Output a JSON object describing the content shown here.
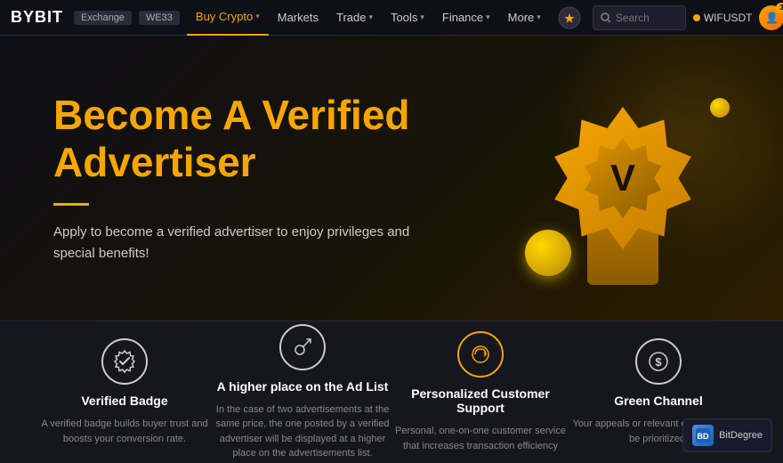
{
  "navbar": {
    "logo": "BYBIT",
    "exchange_tag": "Exchange",
    "we33_tag": "WE33",
    "links": [
      {
        "label": "Buy Crypto",
        "active": true,
        "has_chevron": true
      },
      {
        "label": "Markets",
        "active": false,
        "has_chevron": false
      },
      {
        "label": "Trade",
        "active": false,
        "has_chevron": true
      },
      {
        "label": "Tools",
        "active": false,
        "has_chevron": true
      },
      {
        "label": "Finance",
        "active": false,
        "has_chevron": true
      },
      {
        "label": "More",
        "active": false,
        "has_chevron": true
      }
    ],
    "search_placeholder": "Search",
    "token_label": "WIFUSDT"
  },
  "hero": {
    "title": "Become A Verified Advertiser",
    "description": "Apply to become a verified advertiser to enjoy privileges and special benefits!",
    "badge_letter": "V"
  },
  "features": [
    {
      "id": "verified-badge",
      "title": "Verified Badge",
      "description": "A verified badge builds buyer trust and boosts your conversion rate.",
      "icon": "✓"
    },
    {
      "id": "higher-place",
      "title": "A higher place on the Ad List",
      "description": "In the case of two advertisements at the same price, the one posted by a verified advertiser will be displayed at a higher place on the advertisements list.",
      "icon": "⚡"
    },
    {
      "id": "customer-support",
      "title": "Personalized Customer Support",
      "description": "Personal, one-on-one customer service that increases transaction efficiency",
      "icon": "↻"
    },
    {
      "id": "green-channel",
      "title": "Green Channel",
      "description": "Your appeals or relevant complaints will be prioritized.",
      "icon": "$"
    }
  ],
  "bitdegree": {
    "label": "BitDegree"
  }
}
